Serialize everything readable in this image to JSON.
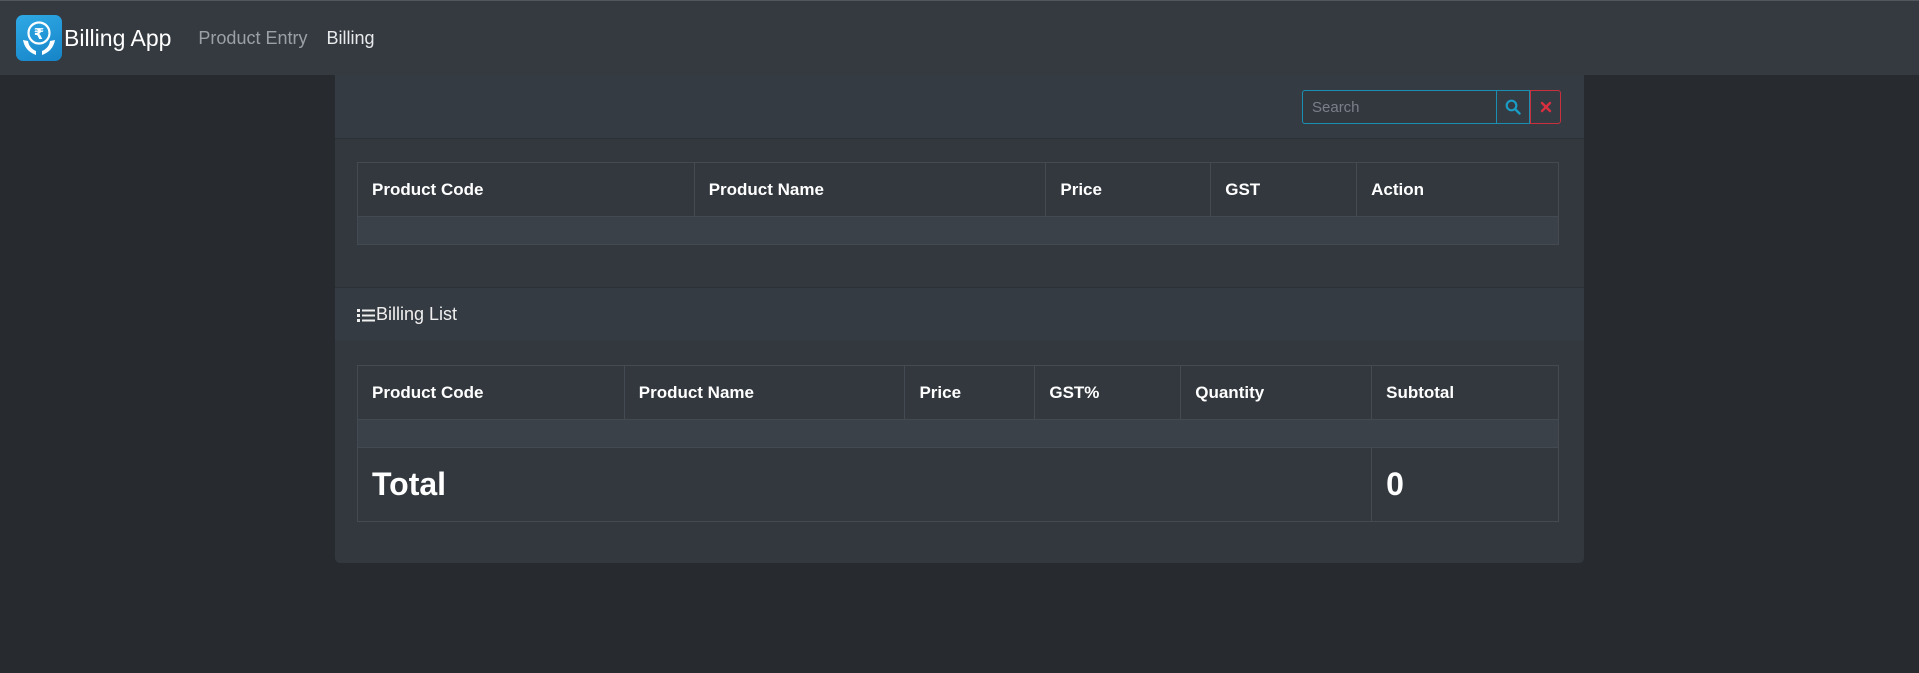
{
  "navbar": {
    "brand": "Billing App",
    "logo_icon": "rupee-hand-icon",
    "links": [
      {
        "label": "Product Entry",
        "active": false
      },
      {
        "label": "Billing",
        "active": true
      }
    ]
  },
  "search": {
    "placeholder": "Search",
    "value": "",
    "search_icon": "search-icon",
    "clear_icon": "close-icon"
  },
  "product_table": {
    "headers": [
      "Product Code",
      "Product Name",
      "Price",
      "GST",
      "Action"
    ],
    "rows": []
  },
  "billing_list": {
    "title": "Billing List",
    "icon": "list-icon",
    "headers": [
      "Product Code",
      "Product Name",
      "Price",
      "GST%",
      "Quantity",
      "Subtotal"
    ],
    "rows": [],
    "total_label": "Total",
    "total_value": "0"
  },
  "colors": {
    "background": "#272b30",
    "navbar": "#353a41",
    "card": "#32383e",
    "info": "#1a8fb3",
    "danger": "#c8303d",
    "logo": "#1f96d6"
  }
}
